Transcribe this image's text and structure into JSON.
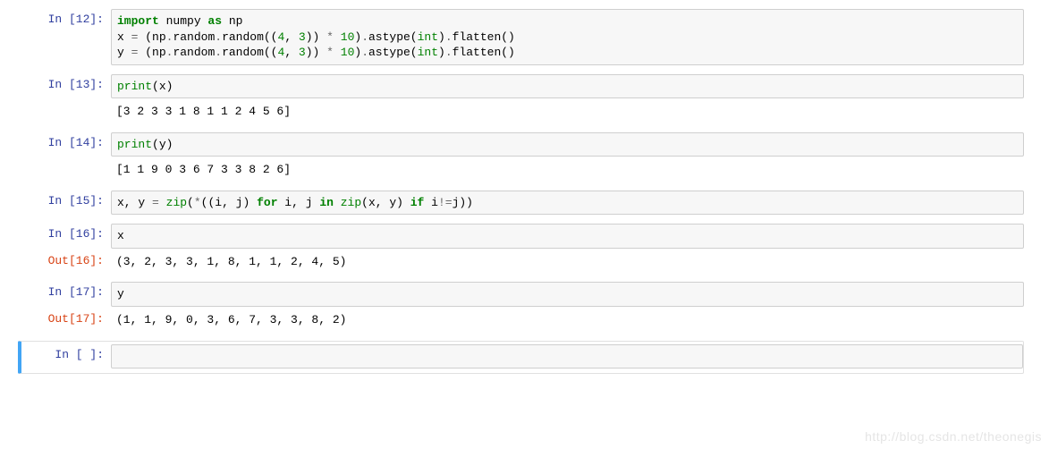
{
  "prompts": {
    "in12": "In [12]:",
    "in13": "In [13]:",
    "in14": "In [14]:",
    "in15": "In [15]:",
    "in16": "In [16]:",
    "out16": "Out[16]:",
    "in17": "In [17]:",
    "out17": "Out[17]:",
    "in_empty": "In [ ]:"
  },
  "code": {
    "c12_l1_import": "import",
    "c12_l1_numpy": " numpy ",
    "c12_l1_as": "as",
    "c12_l1_np": " np",
    "c12_l2_a": "x ",
    "c12_l2_eq": "=",
    "c12_l2_b": " (np",
    "c12_l2_dot1": ".",
    "c12_l2_c": "random",
    "c12_l2_dot2": ".",
    "c12_l2_d": "random((",
    "c12_l2_n1": "4",
    "c12_l2_comma1": ", ",
    "c12_l2_n2": "3",
    "c12_l2_e": ")) ",
    "c12_l2_star": "*",
    "c12_l2_sp1": " ",
    "c12_l2_n3": "10",
    "c12_l2_f": ")",
    "c12_l2_dot3": ".",
    "c12_l2_g": "astype(",
    "c12_l2_int": "int",
    "c12_l2_h": ")",
    "c12_l2_dot4": ".",
    "c12_l2_i": "flatten()",
    "c12_l3_a": "y ",
    "c12_l3_eq": "=",
    "c12_l3_b": " (np",
    "c12_l3_dot1": ".",
    "c12_l3_c": "random",
    "c12_l3_dot2": ".",
    "c12_l3_d": "random((",
    "c12_l3_n1": "4",
    "c12_l3_comma1": ", ",
    "c12_l3_n2": "3",
    "c12_l3_e": ")) ",
    "c12_l3_star": "*",
    "c12_l3_sp1": " ",
    "c12_l3_n3": "10",
    "c12_l3_f": ")",
    "c12_l3_dot3": ".",
    "c12_l3_g": "astype(",
    "c12_l3_int": "int",
    "c12_l3_h": ")",
    "c12_l3_dot4": ".",
    "c12_l3_i": "flatten()",
    "c13_a": "print",
    "c13_b": "(x)",
    "c14_a": "print",
    "c14_b": "(y)",
    "c15_a": "x, y ",
    "c15_eq": "=",
    "c15_b": " ",
    "c15_zip": "zip",
    "c15_c": "(",
    "c15_star": "*",
    "c15_d": "((i, j) ",
    "c15_for": "for",
    "c15_e": " i, j ",
    "c15_in": "in",
    "c15_f": " ",
    "c15_zip2": "zip",
    "c15_g": "(x, y) ",
    "c15_if": "if",
    "c15_h": " i",
    "c15_ne": "!=",
    "c15_i": "j))",
    "c16": "x",
    "c17": "y"
  },
  "outputs": {
    "o13": "[3 2 3 3 1 8 1 1 2 4 5 6]",
    "o14": "[1 1 9 0 3 6 7 3 3 8 2 6]",
    "o16": "(3, 2, 3, 3, 1, 8, 1, 1, 2, 4, 5)",
    "o17": "(1, 1, 9, 0, 3, 6, 7, 3, 3, 8, 2)"
  },
  "watermark": "http://blog.csdn.net/theonegis"
}
